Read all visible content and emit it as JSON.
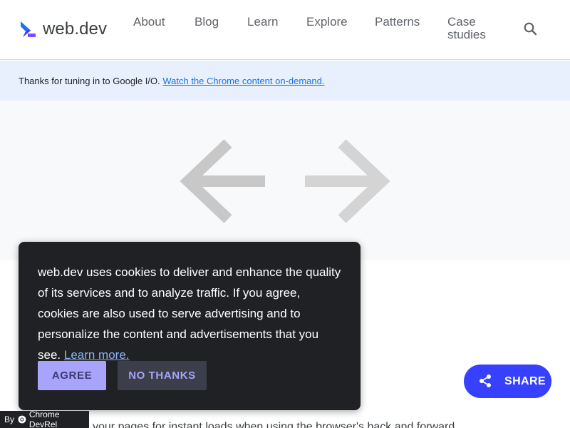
{
  "header": {
    "logo_text": "web.dev",
    "nav": [
      "About",
      "Blog",
      "Learn",
      "Explore",
      "Patterns",
      "Case studies"
    ],
    "search_icon": "search-icon"
  },
  "banner": {
    "text": "Thanks for tuning in to Google I/O. ",
    "link": "Watch the Chrome content on-demand."
  },
  "hero": {
    "icons": [
      "arrow-left-icon",
      "arrow-right-icon"
    ]
  },
  "article": {
    "snippet": "your pages for instant loads when using the browser's back and forward"
  },
  "cookie": {
    "text": "web.dev uses cookies to deliver and enhance the quality of its services and to analyze traffic. If you agree, cookies are also used to serve advertising and to personalize the content and advertisements that you see. ",
    "link": "Learn more.",
    "agree": "AGREE",
    "no_thanks": "NO THANKS"
  },
  "share": {
    "label": "SHARE",
    "icon": "share-icon"
  },
  "badge": {
    "by": "By",
    "label": "Chrome DevRel"
  },
  "colors": {
    "brand_blue": "#3740ff",
    "banner_bg": "#e8f0fe",
    "dialog_bg": "#202124",
    "agree_bg": "#a8a4fb"
  }
}
